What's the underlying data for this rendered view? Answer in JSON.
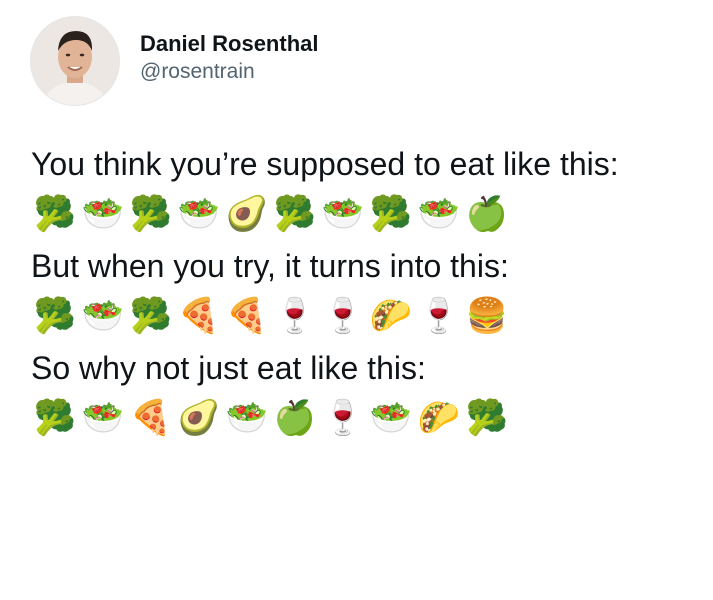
{
  "author": {
    "display_name": "Daniel Rosenthal",
    "handle": "@rosentrain"
  },
  "tweet": {
    "line1": "You think you’re supposed to eat like this:",
    "row1": [
      "🥦",
      "🥗",
      "🥦",
      "🥗",
      "🥑",
      "🥦",
      "🥗",
      "🥦",
      "🥗",
      "🍏"
    ],
    "line2": "But when you try, it turns into this:",
    "row2": [
      "🥦",
      "🥗",
      "🥦",
      "🍕",
      "🍕",
      "🍷",
      "🍷",
      "🌮",
      "🍷",
      "🍔"
    ],
    "line3": "So why not just eat like this:",
    "row3": [
      "🥦",
      "🥗",
      "🍕",
      "🥑",
      "🥗",
      "🍏",
      "🍷",
      "🥗",
      "🌮",
      "🥦"
    ]
  }
}
